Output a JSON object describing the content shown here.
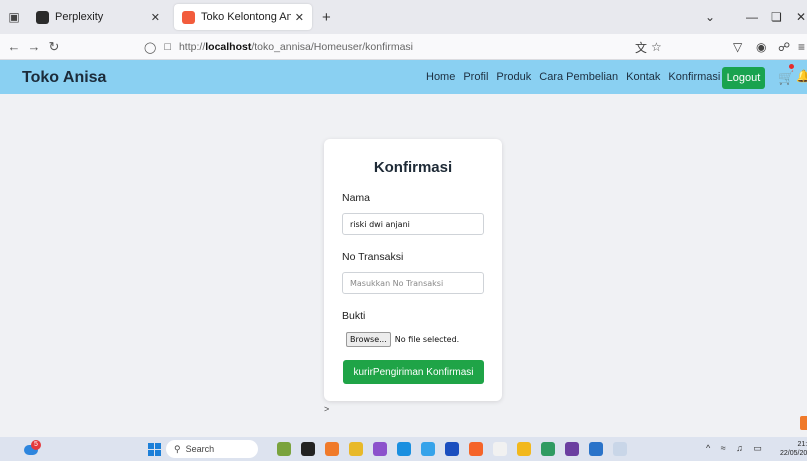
{
  "browser": {
    "tabs": [
      {
        "title": "Perplexity"
      },
      {
        "title": "Toko Kelontong Annisa"
      }
    ],
    "url": {
      "prefix": "http://",
      "host": "localhost",
      "path": "/toko_annisa/Homeuser/konfirmasi"
    }
  },
  "site": {
    "brand": "Toko Anisa",
    "menu": [
      "Home",
      "Profil",
      "Produk",
      "Cara Pembelian",
      "Kontak",
      "Konfirmasi"
    ],
    "logout_label": "Logout"
  },
  "form": {
    "title": "Konfirmasi",
    "nama_label": "Nama",
    "nama_value": "riski dwi anjani",
    "transaksi_label": "No Transaksi",
    "transaksi_placeholder": "Masukkan No Transaksi",
    "bukti_label": "Bukti",
    "browse_label": "Browse...",
    "file_status": "No file selected.",
    "submit_label": "kurirPengiriman Konfirmasi"
  },
  "stray_text": ">",
  "taskbar": {
    "search_label": "Search",
    "weather_badge": "5",
    "time": "21:24",
    "date": "22/05/2025"
  },
  "colors": {
    "header_bg": "#8ad0f2",
    "accent_green": "#19a34f"
  }
}
